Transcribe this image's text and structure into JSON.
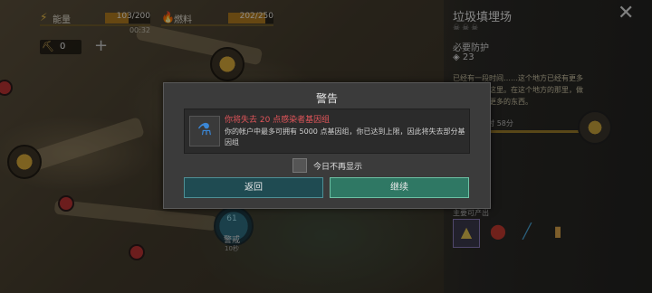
{
  "hud": {
    "energy": {
      "icon": "lightning-icon",
      "label": "能量",
      "value": "103/200",
      "sub": "00:32",
      "fill_fraction": 0.515
    },
    "fuel": {
      "icon": "fuel-drop-icon",
      "label": "燃料",
      "value": "202/250",
      "fill_fraction": 0.81
    },
    "parts": {
      "icon": "parts-icon",
      "value": "0"
    },
    "add_symbol": "+"
  },
  "map": {
    "center_marker_value": "61",
    "center_label": "警戒",
    "center_sub": "10秒"
  },
  "right_panel": {
    "title": "垃圾填埋场",
    "close_symbol": "✕",
    "protection_label": "必要防护",
    "protection_value": "23",
    "description": "已经有一段时间……这个地方已经有更多的东西来到这里。在这个地方的那里，做任务来获得更多的东西。",
    "timer": "23小时 58分",
    "loot_label": "主要可产出"
  },
  "dialog": {
    "title": "警告",
    "warning": "你将失去 20 点感染者基因组",
    "detail": "你的帐户中最多可拥有 5000 点基因组，你已达到上限，因此将失去部分基因组",
    "dont_show_label": "今日不再显示",
    "back_label": "返回",
    "continue_label": "继续",
    "item_icon": "gene-vial-icon"
  },
  "colors": {
    "warning_text": "#e0555a",
    "continue_button": "#2f7864",
    "back_button": "#1f4b52"
  }
}
